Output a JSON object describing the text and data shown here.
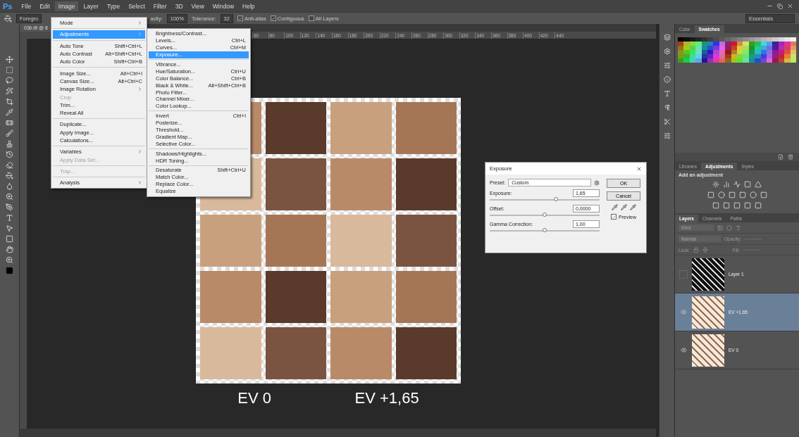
{
  "app_logo": "Ps",
  "menu_bar": [
    {
      "label": "File",
      "selected": false
    },
    {
      "label": "Edit",
      "selected": false
    },
    {
      "label": "Image",
      "selected": true
    },
    {
      "label": "Layer",
      "selected": false
    },
    {
      "label": "Type",
      "selected": false
    },
    {
      "label": "Select",
      "selected": false
    },
    {
      "label": "Filter",
      "selected": false
    },
    {
      "label": "3D",
      "selected": false
    },
    {
      "label": "View",
      "selected": false
    },
    {
      "label": "Window",
      "selected": false
    },
    {
      "label": "Help",
      "selected": false
    }
  ],
  "options_bar": {
    "preset": "Foregro",
    "opacity_label": "acity:",
    "opacity_value": "100%",
    "tolerance_label": "Tolerance:",
    "tolerance_value": "32",
    "checks": [
      {
        "label": "Anti-alias",
        "checked": true
      },
      {
        "label": "Contiguous",
        "checked": true
      },
      {
        "label": "All Layers",
        "checked": false
      }
    ],
    "workspace": "Essentials"
  },
  "document_tab": "03b.tif @ 8",
  "ruler_ticks": [
    "60",
    "80",
    "100",
    "120",
    "140",
    "160",
    "180",
    "200",
    "220",
    "240",
    "260",
    "280",
    "300",
    "320",
    "340",
    "360",
    "380",
    "400",
    "420",
    "440"
  ],
  "image_menu": [
    {
      "kind": "item",
      "label": "Mode",
      "submenu": true,
      "disabled": false,
      "selected": false
    },
    {
      "kind": "separator"
    },
    {
      "kind": "item",
      "label": "Adjustments",
      "submenu": true,
      "disabled": false,
      "selected": true
    },
    {
      "kind": "separator"
    },
    {
      "kind": "item",
      "label": "Auto Tone",
      "shortcut": "Shift+Ctrl+L",
      "submenu": false,
      "disabled": false,
      "selected": false
    },
    {
      "kind": "item",
      "label": "Auto Contrast",
      "shortcut": "Alt+Shift+Ctrl+L",
      "submenu": false,
      "disabled": false,
      "selected": false
    },
    {
      "kind": "item",
      "label": "Auto Color",
      "shortcut": "Shift+Ctrl+B",
      "submenu": false,
      "disabled": false,
      "selected": false
    },
    {
      "kind": "separator"
    },
    {
      "kind": "item",
      "label": "Image Size...",
      "shortcut": "Alt+Ctrl+I",
      "submenu": false,
      "disabled": false,
      "selected": false
    },
    {
      "kind": "item",
      "label": "Canvas Size...",
      "shortcut": "Alt+Ctrl+C",
      "submenu": false,
      "disabled": false,
      "selected": false
    },
    {
      "kind": "item",
      "label": "Image Rotation",
      "submenu": true,
      "disabled": false,
      "selected": false
    },
    {
      "kind": "item",
      "label": "Crop",
      "submenu": false,
      "disabled": true,
      "selected": false
    },
    {
      "kind": "item",
      "label": "Trim...",
      "submenu": false,
      "disabled": false,
      "selected": false
    },
    {
      "kind": "item",
      "label": "Reveal All",
      "submenu": false,
      "disabled": false,
      "selected": false
    },
    {
      "kind": "separator"
    },
    {
      "kind": "item",
      "label": "Duplicate...",
      "submenu": false,
      "disabled": false,
      "selected": false
    },
    {
      "kind": "item",
      "label": "Apply Image...",
      "submenu": false,
      "disabled": false,
      "selected": false
    },
    {
      "kind": "item",
      "label": "Calculations...",
      "submenu": false,
      "disabled": false,
      "selected": false
    },
    {
      "kind": "separator"
    },
    {
      "kind": "item",
      "label": "Variables",
      "submenu": true,
      "disabled": false,
      "selected": false
    },
    {
      "kind": "item",
      "label": "Apply Data Set...",
      "submenu": false,
      "disabled": true,
      "selected": false
    },
    {
      "kind": "separator"
    },
    {
      "kind": "item",
      "label": "Trap...",
      "submenu": false,
      "disabled": true,
      "selected": false
    },
    {
      "kind": "separator"
    },
    {
      "kind": "item",
      "label": "Analysis",
      "submenu": true,
      "disabled": false,
      "selected": false
    }
  ],
  "adjustments_menu": [
    {
      "kind": "item",
      "label": "Brightness/Contrast...",
      "submenu": false,
      "disabled": false,
      "selected": false
    },
    {
      "kind": "item",
      "label": "Levels...",
      "shortcut": "Ctrl+L",
      "submenu": false,
      "disabled": false,
      "selected": false
    },
    {
      "kind": "item",
      "label": "Curves...",
      "shortcut": "Ctrl+M",
      "submenu": false,
      "disabled": false,
      "selected": false
    },
    {
      "kind": "item",
      "label": "Exposure...",
      "submenu": false,
      "disabled": false,
      "selected": true
    },
    {
      "kind": "separator"
    },
    {
      "kind": "item",
      "label": "Vibrance...",
      "submenu": false,
      "disabled": false,
      "selected": false
    },
    {
      "kind": "item",
      "label": "Hue/Saturation...",
      "shortcut": "Ctrl+U",
      "submenu": false,
      "disabled": false,
      "selected": false
    },
    {
      "kind": "item",
      "label": "Color Balance...",
      "shortcut": "Ctrl+B",
      "submenu": false,
      "disabled": false,
      "selected": false
    },
    {
      "kind": "item",
      "label": "Black & White...",
      "shortcut": "Alt+Shift+Ctrl+B",
      "submenu": false,
      "disabled": false,
      "selected": false
    },
    {
      "kind": "item",
      "label": "Photo Filter...",
      "submenu": false,
      "disabled": false,
      "selected": false
    },
    {
      "kind": "item",
      "label": "Channel Mixer...",
      "submenu": false,
      "disabled": false,
      "selected": false
    },
    {
      "kind": "item",
      "label": "Color Lookup...",
      "submenu": false,
      "disabled": false,
      "selected": false
    },
    {
      "kind": "separator"
    },
    {
      "kind": "item",
      "label": "Invert",
      "shortcut": "Ctrl+I",
      "submenu": false,
      "disabled": false,
      "selected": false
    },
    {
      "kind": "item",
      "label": "Posterize...",
      "submenu": false,
      "disabled": false,
      "selected": false
    },
    {
      "kind": "item",
      "label": "Threshold...",
      "submenu": false,
      "disabled": false,
      "selected": false
    },
    {
      "kind": "item",
      "label": "Gradient Map...",
      "submenu": false,
      "disabled": false,
      "selected": false
    },
    {
      "kind": "item",
      "label": "Selective Color...",
      "submenu": false,
      "disabled": false,
      "selected": false
    },
    {
      "kind": "separator"
    },
    {
      "kind": "item",
      "label": "Shadows/Highlights...",
      "submenu": false,
      "disabled": false,
      "selected": false
    },
    {
      "kind": "item",
      "label": "HDR Toning...",
      "submenu": false,
      "disabled": false,
      "selected": false
    },
    {
      "kind": "separator"
    },
    {
      "kind": "item",
      "label": "Desaturate",
      "shortcut": "Shift+Ctrl+U",
      "submenu": false,
      "disabled": false,
      "selected": false
    },
    {
      "kind": "item",
      "label": "Match Color...",
      "submenu": false,
      "disabled": false,
      "selected": false
    },
    {
      "kind": "item",
      "label": "Replace Color...",
      "submenu": false,
      "disabled": false,
      "selected": false
    },
    {
      "kind": "item",
      "label": "Equalize",
      "submenu": false,
      "disabled": false,
      "selected": false
    }
  ],
  "canvas_captions": [
    "EV 0",
    "EV +1,65"
  ],
  "exposure_dialog": {
    "title": "Exposure",
    "preset_label": "Preset:",
    "preset_value": "Custom",
    "buttons": [
      "OK",
      "Cancel"
    ],
    "sliders": [
      {
        "label": "Exposure:",
        "value": "1,65",
        "level": 0.6
      },
      {
        "label": "Offset:",
        "value": "0,0000",
        "level": 0.5
      },
      {
        "label": "Gamma Correction:",
        "value": "1,00",
        "level": 0.5
      }
    ],
    "preview": {
      "label": "Preview",
      "checked": true
    }
  },
  "swatches_panel": {
    "tabs": [
      {
        "label": "Color",
        "selected": false
      },
      {
        "label": "Swatches",
        "selected": true
      }
    ]
  },
  "adjustments_panel": {
    "tabs": [
      {
        "label": "Libraries",
        "selected": false
      },
      {
        "label": "Adjustments",
        "selected": true
      },
      {
        "label": "Styles",
        "selected": false
      }
    ],
    "heading": "Add an adjustment"
  },
  "layers_panel": {
    "tabs": [
      {
        "label": "Layers",
        "selected": true
      },
      {
        "label": "Channels",
        "selected": false
      },
      {
        "label": "Paths",
        "selected": false
      }
    ],
    "filter": "Kind",
    "blend_mode": "Normal",
    "opacity_label": "Opacity:",
    "lock_label": "Lock:",
    "fill_label": "Fill:",
    "layers": [
      {
        "name": "Layer 1",
        "visible": false,
        "selected": false,
        "dark_thumbnail": true
      },
      {
        "name": "EV +1,65",
        "visible": true,
        "selected": true,
        "dark_thumbnail": false
      },
      {
        "name": "EV 0",
        "visible": true,
        "selected": false,
        "dark_thumbnail": false
      }
    ]
  }
}
